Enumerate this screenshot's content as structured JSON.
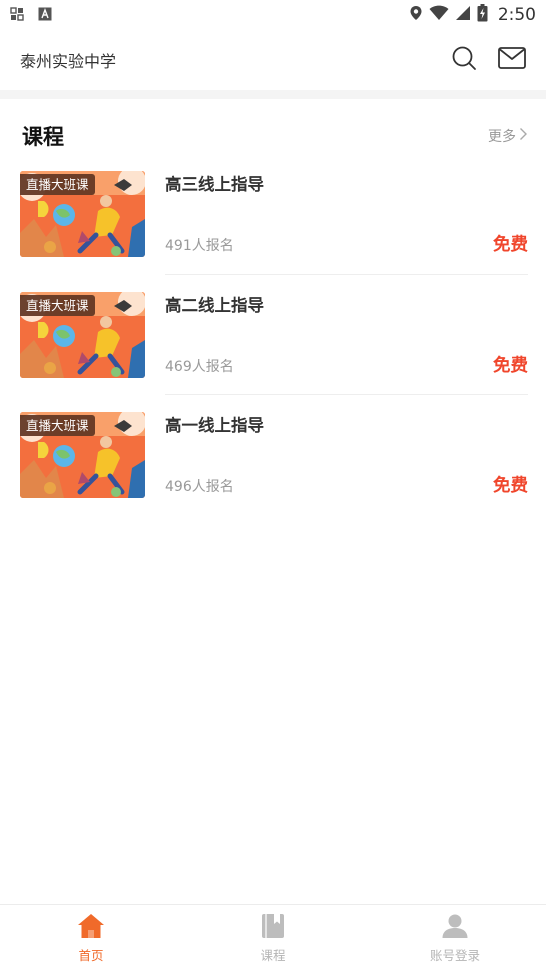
{
  "status_bar": {
    "time": "2:50",
    "icons": [
      "notification-grid-icon",
      "font-a-icon",
      "location-icon",
      "wifi-icon",
      "signal-icon",
      "battery-icon"
    ]
  },
  "header": {
    "school_name": "泰州实验中学",
    "actions": [
      "search-icon",
      "mail-icon"
    ]
  },
  "section": {
    "title": "课程",
    "more_label": "更多"
  },
  "courses": [
    {
      "badge": "直播大班课",
      "title": "高三线上指导",
      "enrolled": "491人报名",
      "price": "免费"
    },
    {
      "badge": "直播大班课",
      "title": "高二线上指导",
      "enrolled": "469人报名",
      "price": "免费"
    },
    {
      "badge": "直播大班课",
      "title": "高一线上指导",
      "enrolled": "496人报名",
      "price": "免费"
    }
  ],
  "bottom_nav": {
    "items": [
      {
        "label": "首页",
        "icon": "home-icon",
        "active": true
      },
      {
        "label": "课程",
        "icon": "book-icon",
        "active": false
      },
      {
        "label": "账号登录",
        "icon": "person-icon",
        "active": false
      }
    ]
  },
  "colors": {
    "accent": "#f06a2a",
    "price": "#f0462c",
    "muted": "#999999",
    "inactive_nav": "#b5b5b5"
  }
}
